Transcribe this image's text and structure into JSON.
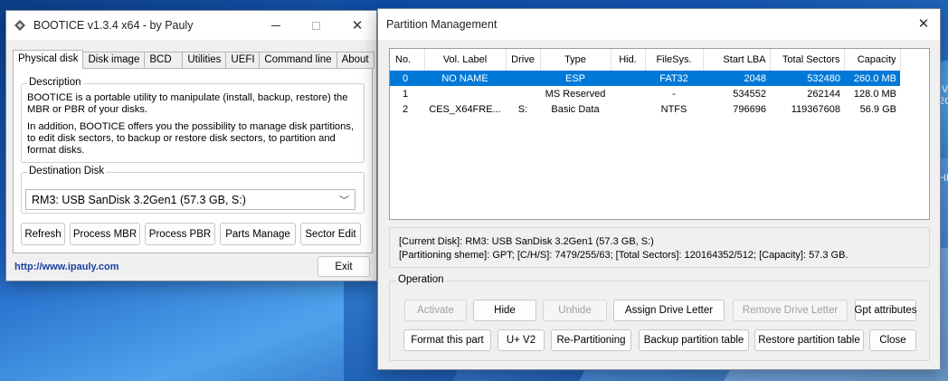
{
  "desktop": {
    "edge_text_1": "IVIE",
    "edge_text_2": "2C",
    "edge_text_3": "HE"
  },
  "bootice": {
    "title": "BOOTICE v1.3.4 x64 - by Pauly",
    "tabs": [
      "Physical disk",
      "Disk image",
      "BCD",
      "Utilities",
      "UEFI",
      "Command line",
      "About"
    ],
    "description_label": "Description",
    "description_p1": "BOOTICE is a portable utility to manipulate (install, backup, restore) the MBR or PBR of your disks.",
    "description_p2": "In addition, BOOTICE offers you the possibility to manage disk partitions, to edit disk sectors, to backup or restore disk sectors, to partition and format disks.",
    "destination_label": "Destination Disk",
    "destination_value": "RM3:  USB SanDisk 3.2Gen1 (57.3 GB, S:)",
    "buttons": {
      "refresh": "Refresh",
      "process_mbr": "Process MBR",
      "process_pbr": "Process PBR",
      "parts_manage": "Parts Manage",
      "sector_edit": "Sector Edit",
      "exit": "Exit"
    },
    "link": "http://www.ipauly.com"
  },
  "partition_management": {
    "title": "Partition Management",
    "columns": [
      "No.",
      "Vol. Label",
      "Drive",
      "Type",
      "Hid.",
      "FileSys.",
      "Start LBA",
      "Total Sectors",
      "Capacity"
    ],
    "rows": [
      {
        "no": "0",
        "vol": "NO NAME",
        "drive": "",
        "type": "ESP",
        "hid": "",
        "fs": "FAT32",
        "start": "2048",
        "total": "532480",
        "cap": "260.0 MB",
        "selected": true
      },
      {
        "no": "1",
        "vol": "",
        "drive": "",
        "type": "MS Reserved",
        "hid": "",
        "fs": "-",
        "start": "534552",
        "total": "262144",
        "cap": "128.0 MB",
        "selected": false
      },
      {
        "no": "2",
        "vol": "CES_X64FRE...",
        "drive": "S:",
        "type": "Basic Data",
        "hid": "",
        "fs": "NTFS",
        "start": "796696",
        "total": "119367608",
        "cap": "56.9 GB",
        "selected": false
      }
    ],
    "info_line1": "[Current Disk]:   RM3:  USB SanDisk 3.2Gen1 (57.3 GB, S:)",
    "info_line2": "[Partitioning sheme]:     GPT;      [C/H/S]:  7479/255/63; [Total Sectors]: 120164352/512; [Capacity]: 57.3 GB.",
    "operation_label": "Operation",
    "buttons": {
      "activate": "Activate",
      "hide": "Hide",
      "unhide": "Unhide",
      "assign_letter": "Assign Drive Letter",
      "remove_letter": "Remove Drive Letter",
      "gpt_attributes": "Gpt attributes",
      "format": "Format this part",
      "uv2": "U+ V2",
      "repartition": "Re-Partitioning",
      "backup_table": "Backup partition table",
      "restore_table": "Restore partition table",
      "close": "Close"
    }
  }
}
